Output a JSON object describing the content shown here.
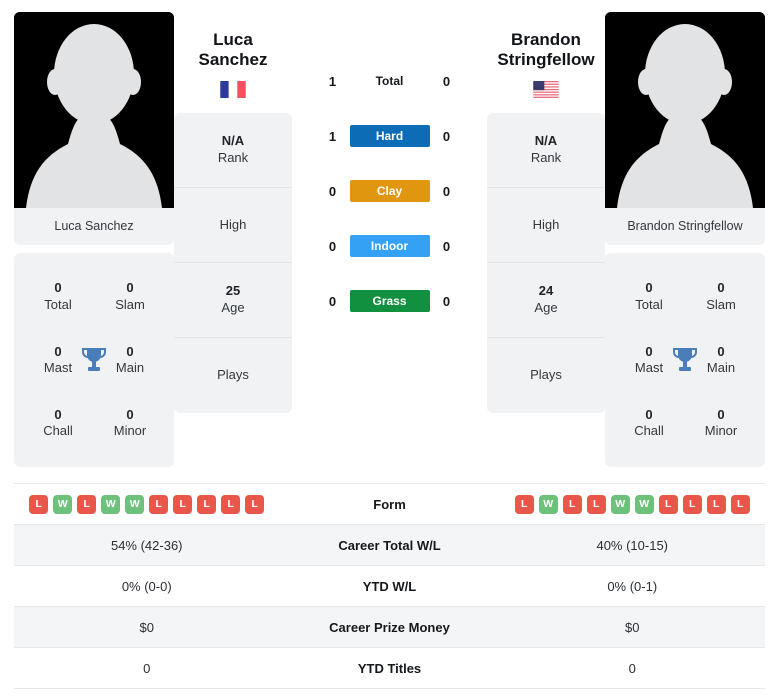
{
  "players": {
    "left": {
      "name_full": "Luca Sanchez",
      "name_line1": "Luca",
      "name_line2": "Sanchez",
      "flag": "france-flag-icon",
      "card_name": "Luca Sanchez",
      "titles": [
        {
          "num": "0",
          "label": "Total"
        },
        {
          "num": "0",
          "label": "Slam"
        },
        {
          "num": "0",
          "label": "Mast"
        },
        {
          "num": "0",
          "label": "Main"
        },
        {
          "num": "0",
          "label": "Chall"
        },
        {
          "num": "0",
          "label": "Minor"
        }
      ],
      "info": [
        {
          "value": "N/A",
          "label": "Rank"
        },
        {
          "value": "",
          "label": "High"
        },
        {
          "value": "25",
          "label": "Age"
        },
        {
          "value": "",
          "label": "Plays"
        }
      ],
      "form": [
        "L",
        "W",
        "L",
        "W",
        "W",
        "L",
        "L",
        "L",
        "L",
        "L"
      ],
      "stats": {
        "career_wl": "54% (42-36)",
        "ytd_wl": "0% (0-0)",
        "career_prize": "$0",
        "ytd_titles": "0"
      }
    },
    "right": {
      "name_full": "Brandon Stringfellow",
      "name_line1": "Brandon",
      "name_line2": "Stringfellow",
      "flag": "usa-flag-icon",
      "card_name": "Brandon Stringfellow",
      "titles": [
        {
          "num": "0",
          "label": "Total"
        },
        {
          "num": "0",
          "label": "Slam"
        },
        {
          "num": "0",
          "label": "Mast"
        },
        {
          "num": "0",
          "label": "Main"
        },
        {
          "num": "0",
          "label": "Chall"
        },
        {
          "num": "0",
          "label": "Minor"
        }
      ],
      "info": [
        {
          "value": "N/A",
          "label": "Rank"
        },
        {
          "value": "",
          "label": "High"
        },
        {
          "value": "24",
          "label": "Age"
        },
        {
          "value": "",
          "label": "Plays"
        }
      ],
      "form": [
        "L",
        "W",
        "L",
        "L",
        "W",
        "W",
        "L",
        "L",
        "L",
        "L"
      ],
      "stats": {
        "career_wl": "40% (10-15)",
        "ytd_wl": "0% (0-1)",
        "career_prize": "$0",
        "ytd_titles": "0"
      }
    }
  },
  "head_to_head": [
    {
      "label": "Total",
      "left": "1",
      "right": "0",
      "style": "plain",
      "color": ""
    },
    {
      "label": "Hard",
      "left": "1",
      "right": "0",
      "style": "badge",
      "color": "#0d6cb6"
    },
    {
      "label": "Clay",
      "left": "0",
      "right": "0",
      "style": "badge",
      "color": "#e0960f"
    },
    {
      "label": "Indoor",
      "left": "0",
      "right": "0",
      "style": "badge",
      "color": "#35a1f5"
    },
    {
      "label": "Grass",
      "left": "0",
      "right": "0",
      "style": "badge",
      "color": "#11903f"
    }
  ],
  "stats_table": [
    {
      "key": "form",
      "label": "Form"
    },
    {
      "key": "career_wl",
      "label": "Career Total W/L"
    },
    {
      "key": "ytd_wl",
      "label": "YTD W/L"
    },
    {
      "key": "career_prize",
      "label": "Career Prize Money"
    },
    {
      "key": "ytd_titles",
      "label": "YTD Titles"
    }
  ],
  "colors": {
    "win": "#6ec17a",
    "loss": "#e8574a",
    "card_bg": "#f1f2f3",
    "row_alt": "#f4f5f6"
  }
}
